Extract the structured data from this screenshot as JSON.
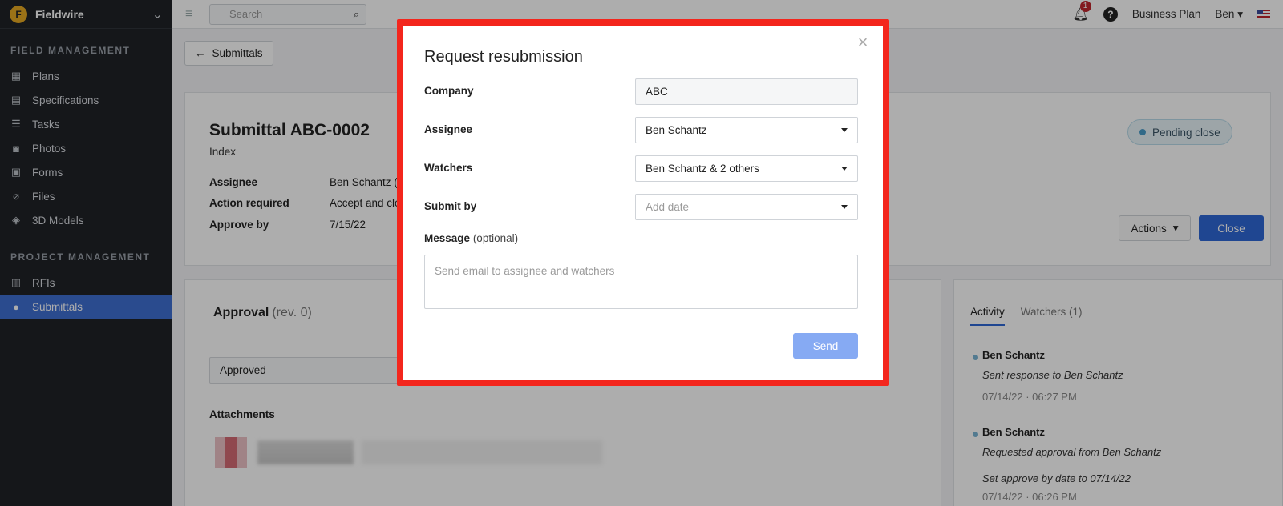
{
  "sidebar": {
    "brand": "Fieldwire",
    "field_title": "FIELD MANAGEMENT",
    "field_items": [
      {
        "label": "Plans"
      },
      {
        "label": "Specifications"
      },
      {
        "label": "Tasks"
      },
      {
        "label": "Photos"
      },
      {
        "label": "Forms"
      },
      {
        "label": "Files"
      },
      {
        "label": "3D Models"
      }
    ],
    "project_title": "PROJECT MANAGEMENT",
    "project_items": [
      {
        "label": "RFIs"
      },
      {
        "label": "Submittals"
      }
    ]
  },
  "topbar": {
    "search_placeholder": "Search",
    "notification_count": "1",
    "help": "?",
    "plan": "Business Plan",
    "user": "Ben"
  },
  "page": {
    "back_label": "Submittals",
    "title": "Submittal ABC-0002",
    "subtitle": "Index",
    "meta": [
      {
        "key": "Assignee",
        "value": "Ben Schantz (A"
      },
      {
        "key": "Action required",
        "value": "Accept and clo"
      },
      {
        "key": "Approve by",
        "value": "7/15/22"
      }
    ],
    "status": "Pending close",
    "actions_label": "Actions",
    "close_label": "Close",
    "approval_title": "Approval",
    "approval_rev": "(rev. 0)",
    "approval_value": "Approved",
    "attachments_title": "Attachments",
    "tabs": [
      {
        "label": "Activity"
      },
      {
        "label": "Watchers (1)"
      }
    ],
    "activity": [
      {
        "who": "Ben Schantz",
        "what": "Sent response to Ben Schantz",
        "when": "07/14/22 · 06:27 PM"
      },
      {
        "who": "Ben Schantz",
        "what": "Requested approval from Ben Schantz",
        "what2": "Set approve by date to 07/14/22",
        "when": "07/14/22 · 06:26 PM"
      }
    ]
  },
  "modal": {
    "title": "Request resubmission",
    "company_label": "Company",
    "company_value": "ABC",
    "assignee_label": "Assignee",
    "assignee_value": "Ben Schantz",
    "watchers_label": "Watchers",
    "watchers_value": "Ben Schantz & 2 others",
    "submit_label": "Submit by",
    "submit_placeholder": "Add date",
    "message_label": "Message",
    "message_optional": "(optional)",
    "message_placeholder": "Send email to assignee and watchers",
    "send_label": "Send"
  },
  "colors": {
    "accent": "#2f67d6",
    "sidebar_bg": "#1f2227",
    "highlight_border": "#f3261d",
    "send_disabled": "#86aaf3"
  }
}
